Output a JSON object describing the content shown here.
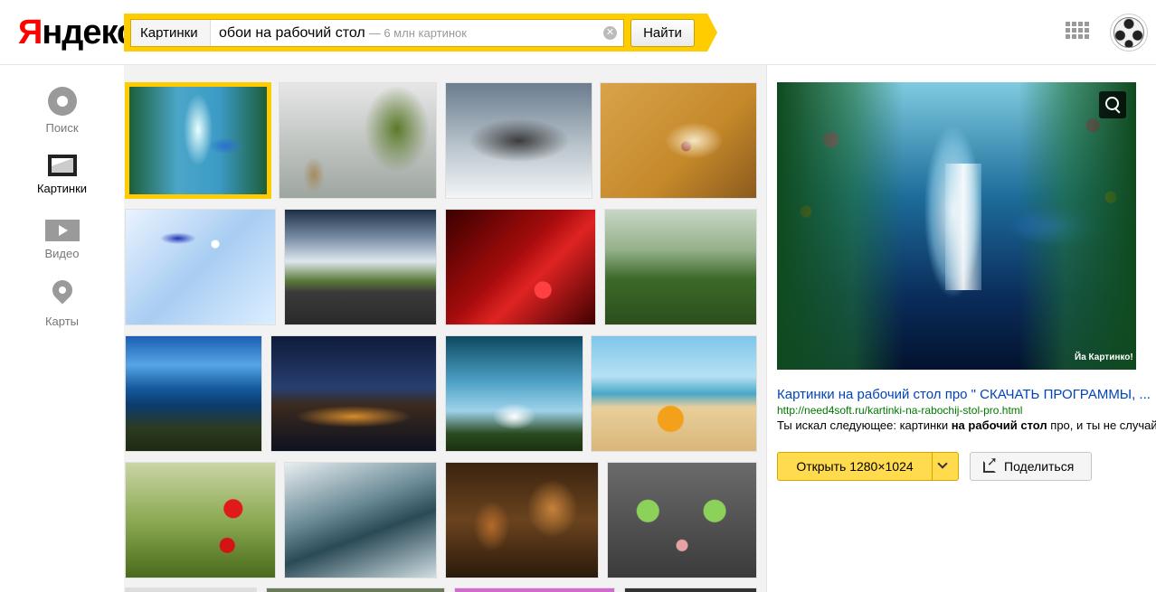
{
  "header": {
    "logo_first": "Я",
    "logo_rest": "ндекс",
    "search_service": "Картинки",
    "search_query": "обои на рабочий стол",
    "search_count": "— 6 млн картинок",
    "search_button": "Найти"
  },
  "leftnav": {
    "items": [
      {
        "label": "Поиск",
        "icon": "search-icon"
      },
      {
        "label": "Картинки",
        "icon": "images-icon"
      },
      {
        "label": "Видео",
        "icon": "video-icon"
      },
      {
        "label": "Карты",
        "icon": "maps-pin-icon"
      }
    ]
  },
  "thumbnails": [
    {
      "subject": "waterfall-dolphin",
      "selected": true
    },
    {
      "subject": "hulk-yoda-dream-big"
    },
    {
      "subject": "snowy-forest"
    },
    {
      "subject": "cream-flower"
    },
    {
      "subject": "blue-glass-ribbon-daisies"
    },
    {
      "subject": "airplane-runway"
    },
    {
      "subject": "red-waterdrop"
    },
    {
      "subject": "green-hill-house"
    },
    {
      "subject": "rocky-coast"
    },
    {
      "subject": "night-town-river"
    },
    {
      "subject": "sky-clouds-sunburst"
    },
    {
      "subject": "starfish-beach"
    },
    {
      "subject": "mushroom-grass"
    },
    {
      "subject": "eiffel-tower-wave"
    },
    {
      "subject": "steampunk-robot"
    },
    {
      "subject": "cat-face"
    }
  ],
  "preview": {
    "watermark": "Йа Картинко!",
    "title": "Картинки на рабочий стол про \" СКАЧАТЬ ПРОГРАММЫ, ...",
    "url": "http://need4soft.ru/kartinki-na-rabochij-stol-pro.html",
    "snippet_before": "Ты искал следующее: картинки ",
    "snippet_bold": "на рабочий стол",
    "snippet_after": " про, и ты не случайно",
    "open_button": "Открыть 1280×1024",
    "share_button": "Поделиться"
  },
  "colors": {
    "accent_yellow": "#ffcc00",
    "logo_red": "#ff0000",
    "link_blue": "#0044bb",
    "url_green": "#007700"
  }
}
